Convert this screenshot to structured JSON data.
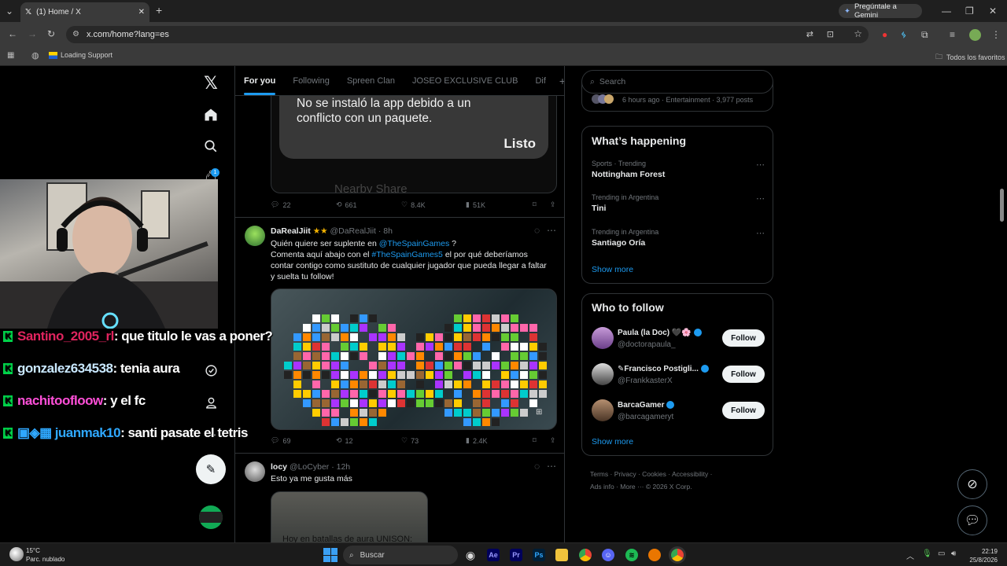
{
  "browser": {
    "tab_title": "(1) Home / X",
    "new_tab_symbol": "+",
    "url": "x.com/home?lang=es",
    "gemini_label": "Pregúntale a Gemini",
    "bookmark_1": "Loading Support",
    "bookmarks_folder": "Todos los favoritos"
  },
  "feed": {
    "tabs": [
      {
        "label": "For you",
        "active": true
      },
      {
        "label": "Following",
        "active": false
      },
      {
        "label": "Spreen Clan",
        "active": false
      },
      {
        "label": "JOSEO EXCLUSIVE CLUB",
        "active": false
      },
      {
        "label": "Dif",
        "active": false
      }
    ],
    "add_tab_symbol": "+",
    "embedded_dialog": {
      "message": "No se instaló la app debido a un conflicto con un paquete.",
      "button": "Listo",
      "partial_text": "Nearby Share"
    },
    "tweet0_stats": {
      "replies": "22",
      "reposts": "661",
      "likes": "8.4K",
      "views": "51K"
    },
    "tweet1": {
      "name": "DaRealJiit",
      "stars": "★★",
      "handle": "@DaRealJiit",
      "time": "· 8h",
      "line1_pre": "Quién quiere ser suplente en ",
      "line1_mention": "@TheSpainGames",
      "line1_post": " ?",
      "line2_pre": "Comenta aquí abajo con el ",
      "line2_tag": "#TheSpainGames5",
      "line2_post": " el por qué deberíamos contar contigo como sustituto de cualquier jugador que pueda llegar a faltar y suelta tu follow!",
      "stats": {
        "replies": "69",
        "reposts": "12",
        "likes": "73",
        "views": "2.4K"
      }
    },
    "tweet2": {
      "name": "locy",
      "handle": "@LoCyber",
      "time": "· 12h",
      "text": "Esto ya me gusta más",
      "image_caption": "Hoy en batallas de aura UNISON:"
    }
  },
  "right": {
    "search_placeholder": "Search",
    "trend_top_meta": "6 hours ago · Entertainment · 3,977 posts",
    "whats_happening": "What’s happening",
    "trends": [
      {
        "meta": "Sports · Trending",
        "name": "Nottingham Forest"
      },
      {
        "meta": "Trending in Argentina",
        "name": "Tini"
      },
      {
        "meta": "Trending in Argentina",
        "name": "Santiago Oría"
      }
    ],
    "show_more": "Show more",
    "who_to_follow": "Who to follow",
    "follows": [
      {
        "name": "Paula (la Doc)",
        "emoji": "🖤🌸",
        "handle": "@doctorapaula_",
        "button": "Follow"
      },
      {
        "name": "Francisco Postigli...",
        "emoji": "✎",
        "handle": "@FrankkasterX",
        "button": "Follow"
      },
      {
        "name": "BarcaGamer",
        "emoji": "",
        "handle": "@barcagameryt",
        "button": "Follow"
      }
    ],
    "show_more_2": "Show more",
    "footer": [
      "Terms",
      "Privacy",
      "Cookies",
      "Accessibility",
      "Ads info",
      "More ···",
      "© 2026 X Corp."
    ]
  },
  "stream_chat": [
    {
      "user": "Santino_2005_rl",
      "color": "#e0245e",
      "message": ": que titulo le vas a poner?"
    },
    {
      "user": "gonzalez634538",
      "color": "#c9e8ff",
      "message": ": tenia aura"
    },
    {
      "user": "nachitoofloow",
      "color": "#ff4fd8",
      "message": ": y el fc"
    },
    {
      "user": "juanmak10",
      "color": "#2fa8ff",
      "message": ": santi pasate el tetris"
    }
  ],
  "nav_badge": "1",
  "taskbar": {
    "weather_temp": "15°C",
    "weather_desc": "Parc. nublado",
    "search": "Buscar",
    "time": "22:19",
    "date": "25/8/2026"
  },
  "colors": {
    "accent": "#1d9bf0",
    "bg": "#000000",
    "border": "#2f3336",
    "muted": "#71767b"
  }
}
